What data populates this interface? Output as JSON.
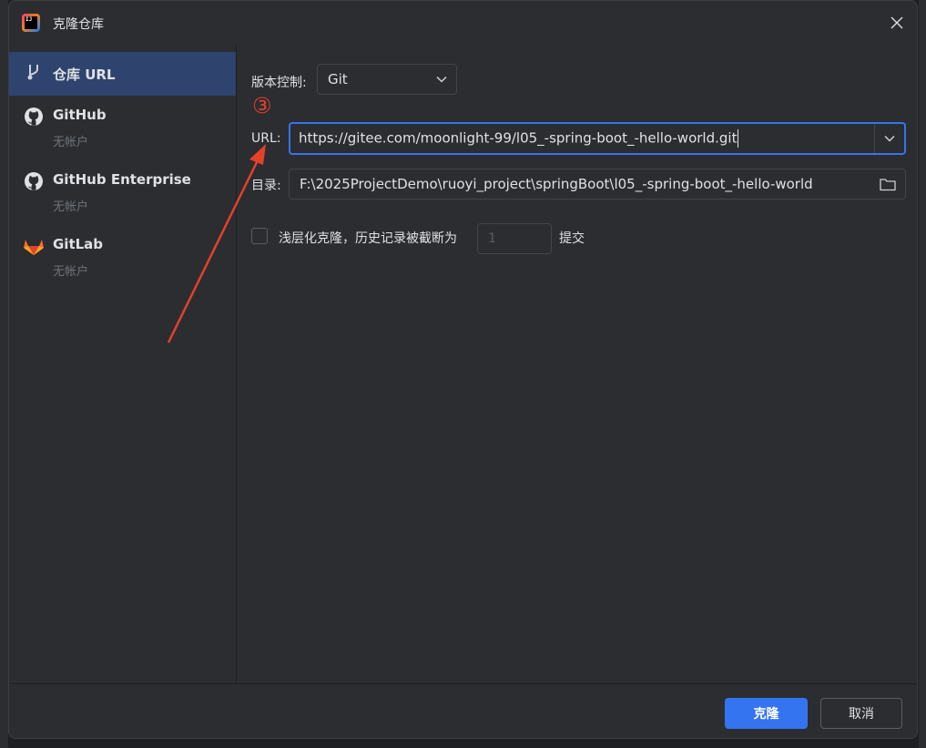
{
  "window": {
    "title": "克隆仓库",
    "app_icon_text": "IJ"
  },
  "sidebar": {
    "items": [
      {
        "label": "仓库 URL",
        "sub": "",
        "icon": "git-branch-icon",
        "active": true
      },
      {
        "label": "GitHub",
        "sub": "无帐户",
        "icon": "github-icon",
        "active": false
      },
      {
        "label": "GitHub Enterprise",
        "sub": "无帐户",
        "icon": "github-icon",
        "active": false
      },
      {
        "label": "GitLab",
        "sub": "无帐户",
        "icon": "gitlab-icon",
        "active": false
      }
    ]
  },
  "form": {
    "vcs_label": "版本控制:",
    "vcs_value": "Git",
    "url_label": "URL:",
    "url_value": "https://gitee.com/moonlight-99/l05_-spring-boot_-hello-world.git",
    "dir_label": "目录:",
    "dir_value": "F:\\2025ProjectDemo\\ruoyi_project\\springBoot\\l05_-spring-boot_-hello-world",
    "shallow_label": "浅层化克隆，历史记录被截断为",
    "shallow_checked": false,
    "shallow_depth": "1",
    "shallow_suffix": "提交"
  },
  "annotation": {
    "number": "③",
    "color": "#e5402c"
  },
  "footer": {
    "clone_label": "克隆",
    "cancel_label": "取消"
  },
  "colors": {
    "accent": "#3574f0",
    "selection": "#2e436e",
    "background": "#2b2d30"
  }
}
